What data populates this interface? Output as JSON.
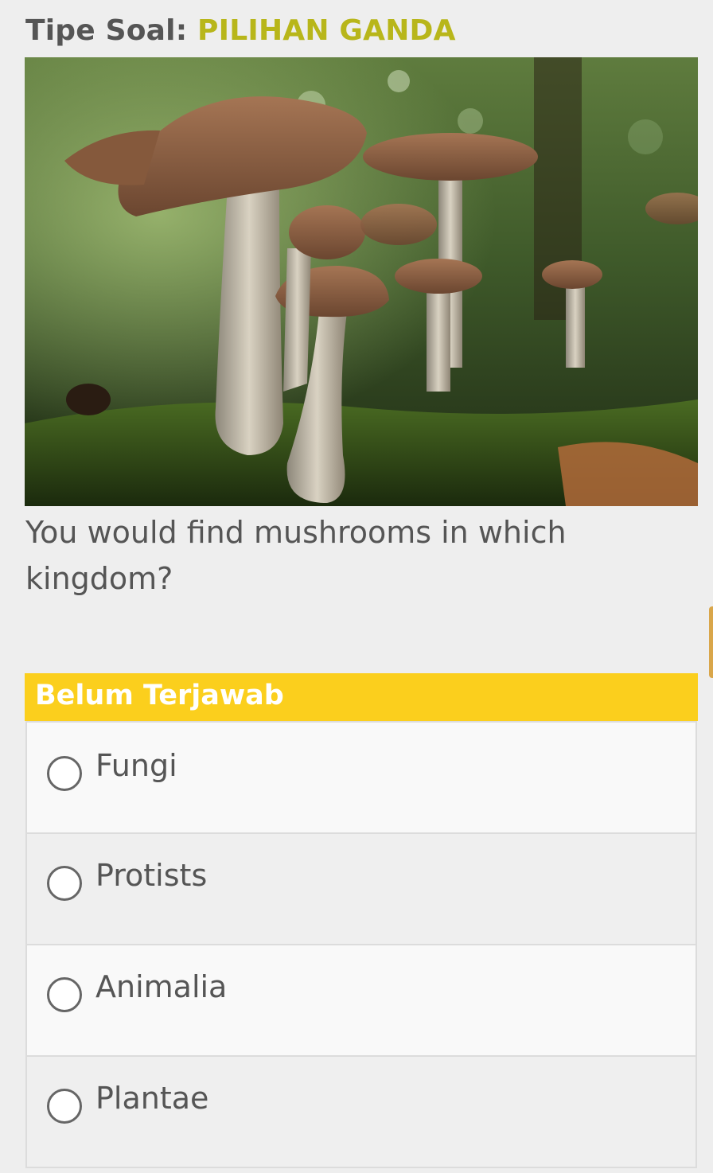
{
  "header": {
    "label": "Tipe Soal:",
    "question_type": "PILIHAN GANDA"
  },
  "question": {
    "image_description": "photo-mushrooms",
    "text": "You would find mushrooms in which kingdom?"
  },
  "status": {
    "label": "Belum Terjawab",
    "color": "#fbcf1d"
  },
  "options": [
    {
      "label": "Fungi",
      "selected": false
    },
    {
      "label": "Protists",
      "selected": false
    },
    {
      "label": "Animalia",
      "selected": false
    },
    {
      "label": "Plantae",
      "selected": false
    }
  ],
  "colors": {
    "accent": "#b8b61a",
    "status_bar": "#fbcf1d",
    "text": "#555555"
  }
}
